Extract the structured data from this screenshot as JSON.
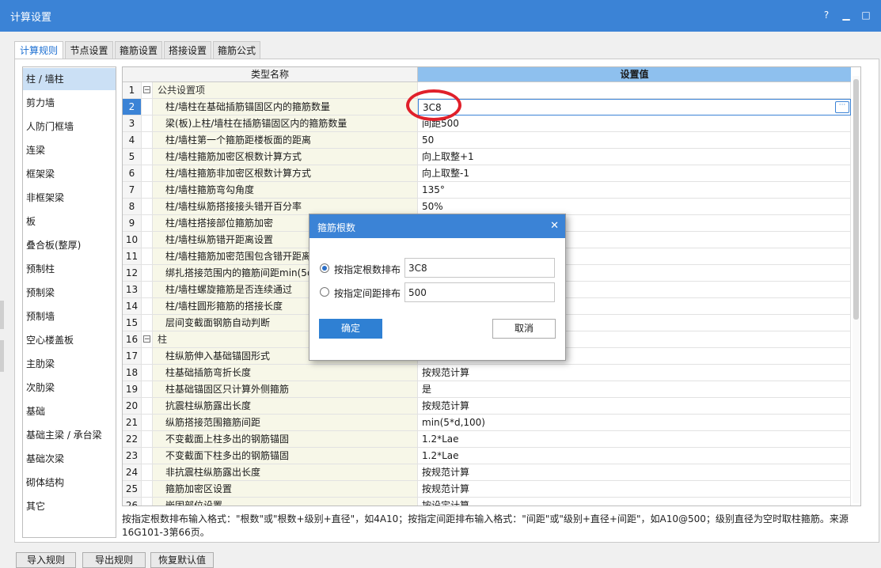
{
  "window": {
    "title": "计算设置"
  },
  "tabs": [
    "计算规则",
    "节点设置",
    "箍筋设置",
    "搭接设置",
    "箍筋公式"
  ],
  "sidebar": {
    "items": [
      "柱 / 墙柱",
      "剪力墙",
      "人防门框墙",
      "连梁",
      "框架梁",
      "非框架梁",
      "板",
      "叠合板(整厚)",
      "预制柱",
      "预制梁",
      "预制墙",
      "空心楼盖板",
      "主肋梁",
      "次肋梁",
      "基础",
      "基础主梁 / 承台梁",
      "基础次梁",
      "砌体结构",
      "其它"
    ]
  },
  "grid": {
    "headers": {
      "name": "类型名称",
      "value": "设置值"
    },
    "rows": [
      {
        "num": "1",
        "name": "公共设置项",
        "value": ""
      },
      {
        "num": "2",
        "name": "柱/墙柱在基础插筋锚固区内的箍筋数量",
        "value": "3C8"
      },
      {
        "num": "3",
        "name": "梁(板)上柱/墙柱在插筋锚固区内的箍筋数量",
        "value": "间距500"
      },
      {
        "num": "4",
        "name": "柱/墙柱第一个箍筋距楼板面的距离",
        "value": "50"
      },
      {
        "num": "5",
        "name": "柱/墙柱箍筋加密区根数计算方式",
        "value": "向上取整+1"
      },
      {
        "num": "6",
        "name": "柱/墙柱箍筋非加密区根数计算方式",
        "value": "向上取整-1"
      },
      {
        "num": "7",
        "name": "柱/墙柱箍筋弯勾角度",
        "value": "135°"
      },
      {
        "num": "8",
        "name": "柱/墙柱纵筋搭接接头错开百分率",
        "value": "50%"
      },
      {
        "num": "9",
        "name": "柱/墙柱搭接部位箍筋加密",
        "value": ""
      },
      {
        "num": "10",
        "name": "柱/墙柱纵筋错开距离设置",
        "value": ""
      },
      {
        "num": "11",
        "name": "柱/墙柱箍筋加密范围包含错开距离",
        "value": ""
      },
      {
        "num": "12",
        "name": "绑扎搭接范围内的箍筋间距min(5d",
        "value": ""
      },
      {
        "num": "13",
        "name": "柱/墙柱螺旋箍筋是否连续通过",
        "value": ""
      },
      {
        "num": "14",
        "name": "柱/墙柱圆形箍筋的搭接长度",
        "value": ""
      },
      {
        "num": "15",
        "name": "层间变截面钢筋自动判断",
        "value": ""
      },
      {
        "num": "16",
        "name": "柱",
        "value": ""
      },
      {
        "num": "17",
        "name": "柱纵筋伸入基础锚固形式",
        "value": ""
      },
      {
        "num": "18",
        "name": "柱基础插筋弯折长度",
        "value": "按规范计算"
      },
      {
        "num": "19",
        "name": "柱基础锚固区只计算外侧箍筋",
        "value": "是"
      },
      {
        "num": "20",
        "name": "抗震柱纵筋露出长度",
        "value": "按规范计算"
      },
      {
        "num": "21",
        "name": "纵筋搭接范围箍筋间距",
        "value": "min(5*d,100)"
      },
      {
        "num": "22",
        "name": "不变截面上柱多出的钢筋锚固",
        "value": "1.2*Lae"
      },
      {
        "num": "23",
        "name": "不变截面下柱多出的钢筋锚固",
        "value": "1.2*Lae"
      },
      {
        "num": "24",
        "name": "非抗震柱纵筋露出长度",
        "value": "按规范计算"
      },
      {
        "num": "25",
        "name": "箍筋加密区设置",
        "value": "按规范计算"
      },
      {
        "num": "26",
        "name": "嵌固部位设置",
        "value": "按设定计算"
      }
    ]
  },
  "hint": "按指定根数排布输入格式：\"根数\"或\"根数+级别+直径\"，如4A10；按指定间距排布输入格式：\"间距\"或\"级别+直径+间距\"，如A10@500；级别直径为空时取柱箍筋。来源16G101-3第66页。",
  "bottom_buttons": [
    "导入规则",
    "导出规则",
    "恢复默认值"
  ],
  "dialog": {
    "title": "箍筋根数",
    "option1": {
      "label": "按指定根数排布",
      "value": "3C8",
      "selected": true
    },
    "option2": {
      "label": "按指定间距排布",
      "value": "500",
      "selected": false
    },
    "ok": "确定",
    "cancel": "取消"
  },
  "colors": {
    "accent": "#3b83d6",
    "highlight_circle": "#e0202a"
  }
}
